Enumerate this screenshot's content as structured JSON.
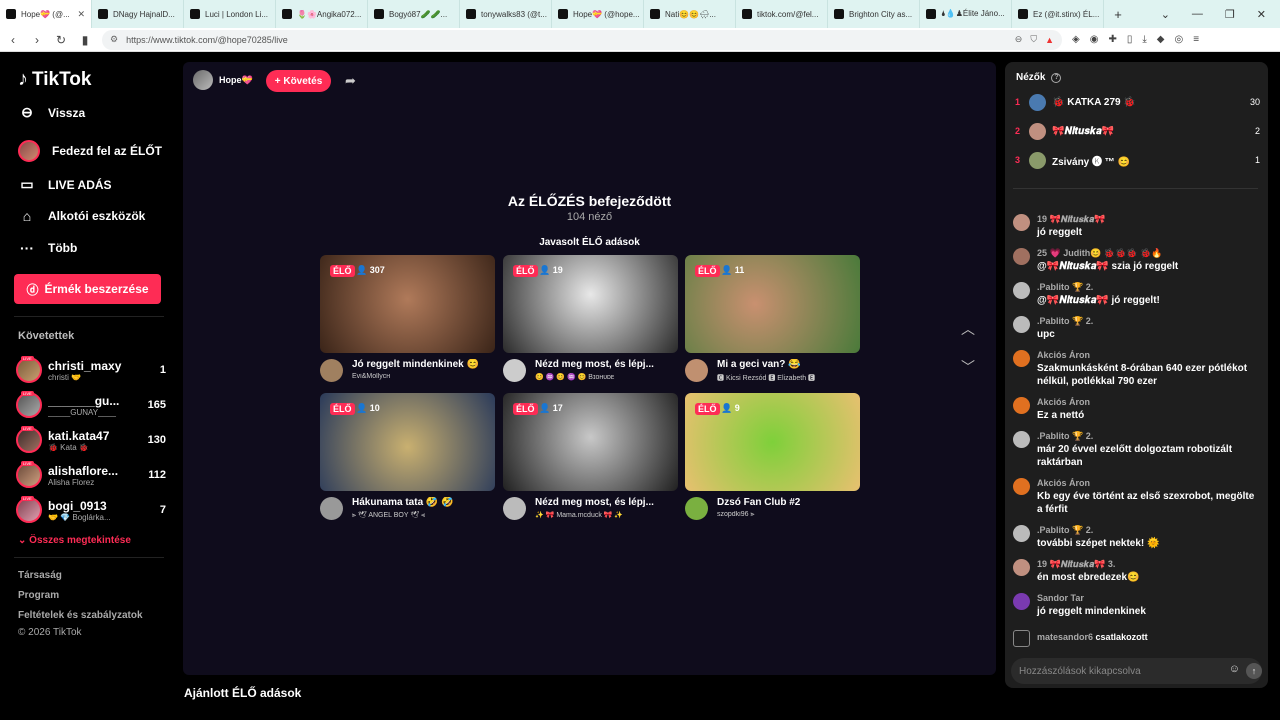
{
  "browser": {
    "tabs": [
      "Hope💝 (@...",
      "DNagy HajnalD...",
      "Luci | London Li...",
      "🌷🌸Angika072...",
      "Bogyó87🥒🥒...",
      "tonywalks83 (@t...",
      "Hope💝 (@hope...",
      "Nati😊😊🌧...",
      "tiktok.com/@fel...",
      "Brighton City as...",
      "🌢💧♟Élite Jáno...",
      "Ez (@it.stinx) ÉL..."
    ],
    "new_tab": "+",
    "url": "https://www.tiktok.com/@hope70285/live"
  },
  "sidebar": {
    "logo": "TikTok",
    "back": "Vissza",
    "nav": [
      "Fedezd fel az ÉLŐT",
      "LIVE ADÁS",
      "Alkotói eszközök",
      "Több"
    ],
    "coins_button": "Érmék beszerzése",
    "followed_title": "Követettek",
    "followed": [
      {
        "name": "christi_maxy",
        "sub": "christi 🤝",
        "count": "1"
      },
      {
        "name": "_______gu...",
        "sub": "_____GUNAY____",
        "count": "165"
      },
      {
        "name": "kati.kata47",
        "sub": "🐞 Kata 🐞",
        "count": "130"
      },
      {
        "name": "alishaflore...",
        "sub": "Alisha Florez",
        "count": "112"
      },
      {
        "name": "bogi_0913",
        "sub": "🤝 💎 Boglárka...",
        "count": "7"
      }
    ],
    "see_all": "Összes megtekintése",
    "footer": [
      "Társaság",
      "Program",
      "Feltételek és szabályzatok",
      "© 2026 TikTok"
    ]
  },
  "main": {
    "host_name": "Hope💝",
    "follow_button": "+ Követés",
    "ended_title": "Az ÉLŐZÉS befejeződött",
    "ended_sub": "104 néző",
    "recommended_title": "Javasolt ÉLŐ adások",
    "live_label": "ÉLŐ",
    "cards": [
      {
        "viewers": "307",
        "title": "Jó reggelt mindenkinek 😊",
        "user": "Evi&Mollyᴄʜ"
      },
      {
        "viewers": "19",
        "title": "Nézd meg most, és lépj...",
        "user": "😊 ♒ 😊 ♒ 😊 Bɪᴏʜᴜᴅᴇ"
      },
      {
        "viewers": "11",
        "title": "Mi a geci van? 😂",
        "user": "🅲 Kicsi Rezsód 🅴 Elizabeth 🅴"
      },
      {
        "viewers": "10",
        "title": "Hákunama tata 🤣 🤣",
        "user": "⫸ 🕊 ANGEL BOY 🕊 ⫷"
      },
      {
        "viewers": "17",
        "title": "Nézd meg most, és lépj...",
        "user": "✨ 🎀 Mama.mcduck 🎀 ✨"
      },
      {
        "viewers": "9",
        "title": "Dzsó Fan Club #2",
        "user": "szopdki96 ⫸"
      }
    ],
    "bottom_title": "Ajánlott ÉLŐ adások"
  },
  "chat": {
    "title": "Nézők",
    "viewers": [
      {
        "rank": "1",
        "name": "🐞 KATKA 279 🐞",
        "score": "30"
      },
      {
        "rank": "2",
        "name": "🎀𝑵𝒊𝒕𝒖𝒔𝒌𝒂🎀",
        "score": "2"
      },
      {
        "rank": "3",
        "name": "Zsivány 🅚 ™ 😊",
        "score": "1"
      }
    ],
    "messages": [
      {
        "name": "19 🎀𝑵𝒊𝒕𝒖𝒔𝒌𝒂🎀",
        "text": "jó reggelt"
      },
      {
        "name": "25 💗 Judith😊 🐞🐞🐞 🐞🔥",
        "text": "@🎀𝑵𝒊𝒕𝒖𝒔𝒌𝒂🎀 szia jó reggelt"
      },
      {
        "name": ".Pablito 🏆 2.",
        "text": "@🎀𝑵𝒊𝒕𝒖𝒔𝒌𝒂🎀 jó reggelt!"
      },
      {
        "name": ".Pablito 🏆 2.",
        "text": "upc"
      },
      {
        "name": "Akciós Áron",
        "text": "Szakmunkásként 8-órában 640 ezer pótlékot nélkül, potlékkal 790 ezer"
      },
      {
        "name": "Akciós Áron",
        "text": "Ez a nettó"
      },
      {
        "name": ".Pablito 🏆 2.",
        "text": "már 20 évvel ezelőtt dolgoztam robotizált raktárban"
      },
      {
        "name": "Akciós Áron",
        "text": "Kb egy éve történt az első szexrobot, megölte a férfit"
      },
      {
        "name": ".Pablito 🏆 2.",
        "text": "további szépet nektek! 🌞"
      },
      {
        "name": "19 🎀𝑵𝒊𝒕𝒖𝒔𝒌𝒂🎀 3.",
        "text": "én most ebredezek😊"
      },
      {
        "name": "Sandor Tar",
        "text": "jó reggelt mindenkinek"
      }
    ],
    "join_user": "matesandor6",
    "join_text": "csatlakozott",
    "input_placeholder": "Hozzászólások kikapcsolva"
  }
}
